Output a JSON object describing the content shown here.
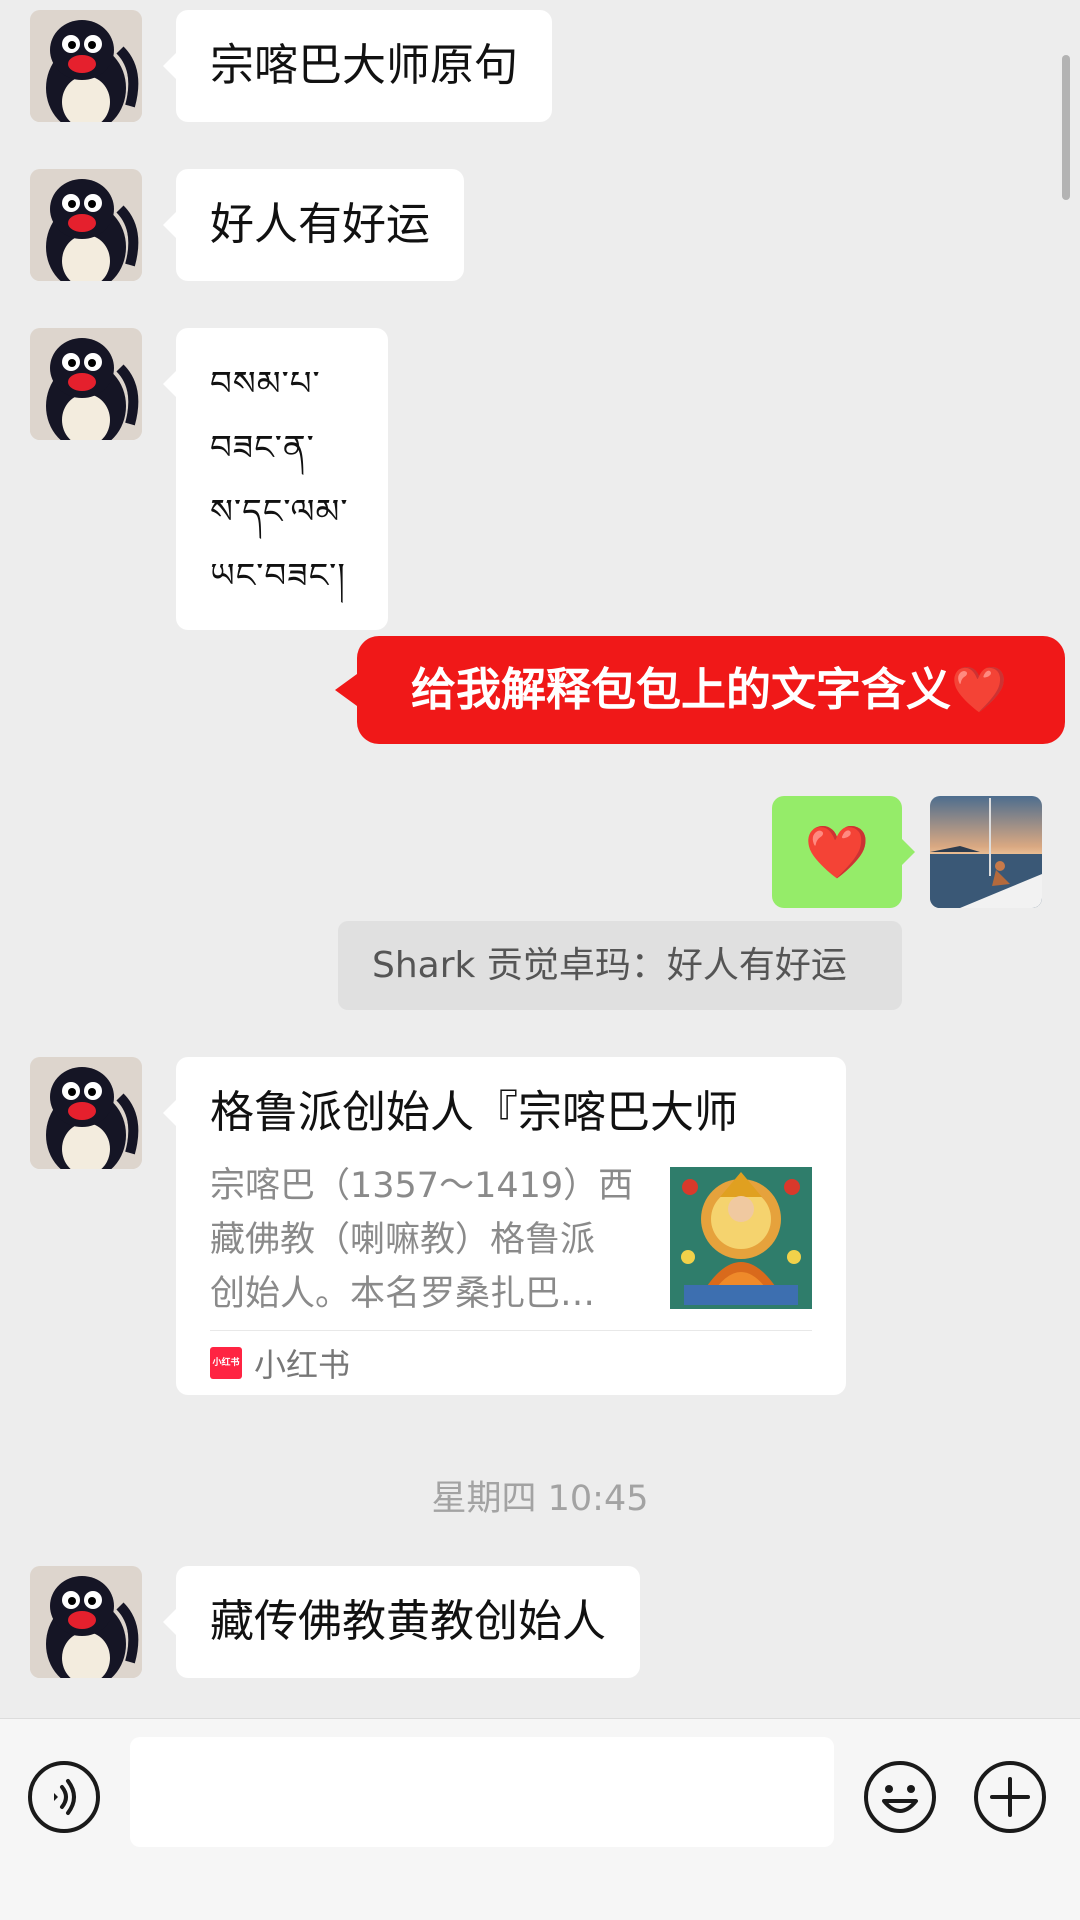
{
  "messages": {
    "msg1": "宗喀巴大师原句",
    "msg2": "好人有好运",
    "tibetan_lines": [
      "བསམ་པ་",
      "བཟང་ན་",
      "ས་དང་ལམ་",
      "ཡང་བཟང་།"
    ],
    "red_message": "给我解释包包上的文字含义❤️",
    "green_message": "❤️",
    "quote": "Shark 贡觉卓玛：好人有好运",
    "msg_last": "藏传佛教黄教创始人"
  },
  "link_card": {
    "title": "格鲁派创始人『宗喀巴大师",
    "desc_lines": [
      "宗喀巴（1357～1419）西",
      "藏佛教（喇嘛教）格鲁派",
      "创始人。本名罗桑扎巴…"
    ],
    "source_logo": "小红书",
    "source": "小红书"
  },
  "timestamp": "星期四 10:45",
  "input": {
    "placeholder": ""
  },
  "icons": {
    "voice": "voice-icon",
    "emoji": "emoji-icon",
    "plus": "plus-icon"
  },
  "colors": {
    "background": "#ededed",
    "incoming_bubble": "#ffffff",
    "outgoing_bubble": "#95ec69",
    "highlight_bubble": "#f01818",
    "quote_bg": "#e0e0e0"
  }
}
